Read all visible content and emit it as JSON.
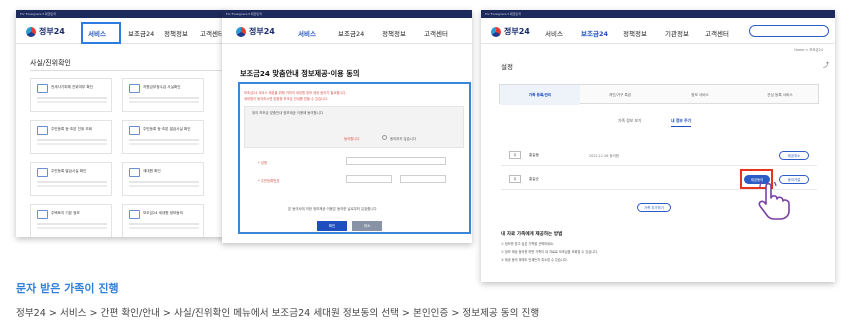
{
  "top_strip": "For Foreigners ▾   대한민국",
  "logo": "정부24",
  "panel1": {
    "nav": [
      "서비스",
      "보조금24",
      "정책정보",
      "고객센터"
    ],
    "title": "사실/진위확인",
    "cards": [
      "전세사기피해 진위여부 확인",
      "지원금부정수급 사실확인",
      "주민등록 등·초본 진위 조회",
      "주민등록 등·초본 발급사실 확인",
      "주민등록 발급사실 확인",
      "세대원 확인",
      "주택토지 기본 정보",
      "보조금24 세대원 정보동의"
    ]
  },
  "panel2": {
    "nav": [
      "서비스",
      "보조금24",
      "정책정보",
      "고객센터"
    ],
    "title": "보조금24 맞춤안내 정보제공·이용 동의",
    "notice1": "보조금24 서비스 제공을 위해 귀하의 세대원 정보 제공 동의가 필요합니다.",
    "notice2": "세대원이 동의하시면 맞춤형 보조금 안내를 받을 수 있습니다.",
    "consent_text": "위의 보조금 맞춤안내 정보제공 이용에 동의합니다",
    "radio_agree": "동의합니다",
    "radio_disagree": "동의하지 않습니다",
    "label_name": "* 성명",
    "label_rrn": "* 주민등록번호",
    "bottom_note": "본 동의서에 의한 정보제공·이용은 동의한 날로부터 유효합니다",
    "btn_confirm": "확인",
    "btn_cancel": "취소"
  },
  "panel3": {
    "nav": [
      "서비스",
      "보조금24",
      "정책정보",
      "기관정보",
      "고객센터"
    ],
    "breadcrumb": "Home > 보조금24",
    "title": "설정",
    "tabs": [
      "가족 등록/관리",
      "개인/가구 특성",
      "정보 서비스",
      "관심 등록 서비스"
    ],
    "subtabs": [
      "가족 정보 보기",
      "내 정보 주기"
    ],
    "rows": [
      {
        "tag": "자",
        "name": "홍길동",
        "date": "2022.11.26 동의함",
        "action": "제공취소"
      },
      {
        "tag": "자",
        "name": "홍길순",
        "date": "",
        "action_primary": "제공동의",
        "action": "동의거절"
      }
    ],
    "add_button": "가족 추가하기",
    "note_title": "내 자료 가족에게 제공하는 방법",
    "notes": [
      "① 정보를 받고 싶은 가족을 선택하세요.",
      "② 정보 제공 동의를 하면 가족이 내 자료로 보조금을 조회할 수 있습니다.",
      "③ 제공 동의 후에도 언제든지 취소할 수 있습니다."
    ]
  },
  "caption": "문자 받은 가족이 진행",
  "path": "정부24 > 서비스 > 간편 확인/안내 > 사실/진위확인 메뉴에서 보조금24 세대원 정보동의 선택 > 본인인증 > 정보제공 동의 진행"
}
